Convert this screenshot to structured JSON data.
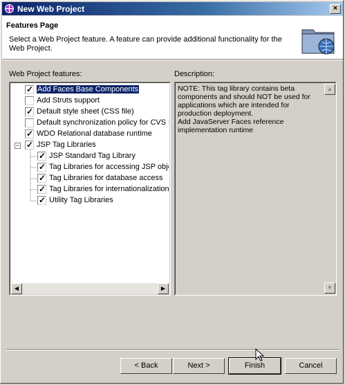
{
  "window": {
    "title": "New Web Project",
    "close_glyph": "×"
  },
  "header": {
    "title": "Features Page",
    "description": "Select a Web Project feature.  A feature can provide additional functionality for the Web Project."
  },
  "features": {
    "label": "Web Project features:",
    "items": [
      {
        "label": "Add Faces Base Components",
        "checked": true,
        "selected": true
      },
      {
        "label": "Add Struts support",
        "checked": false
      },
      {
        "label": "Default style sheet (CSS file)",
        "checked": true
      },
      {
        "label": "Default synchronization policy for CVS re",
        "checked": false
      },
      {
        "label": "WDO Relational database runtime",
        "checked": true
      },
      {
        "label": "JSP Tag Libraries",
        "checked": true,
        "expanded": true
      },
      {
        "label": "JSP Standard Tag Library",
        "checked": true,
        "child": true
      },
      {
        "label": "Tag Libraries for accessing JSP objec",
        "checked": true,
        "child": true
      },
      {
        "label": "Tag Libraries for database access",
        "checked": true,
        "child": true
      },
      {
        "label": "Tag Libraries for internationalization",
        "checked": true,
        "child": true
      },
      {
        "label": "Utility Tag Libraries",
        "checked": true,
        "child": true
      }
    ]
  },
  "description": {
    "label": "Description:",
    "text": "NOTE: This tag library contains beta\ncomponents and should NOT be used for\napplications which are intended for\nproduction deployment.\nAdd JavaServer Faces reference\nimplementation runtime"
  },
  "buttons": {
    "back": "< Back",
    "next": "Next >",
    "finish": "Finish",
    "cancel": "Cancel"
  },
  "icons": {
    "checkmark": "✓",
    "collapse": "−",
    "up": "▲",
    "down": "▼",
    "left": "◀",
    "right": "▶"
  }
}
